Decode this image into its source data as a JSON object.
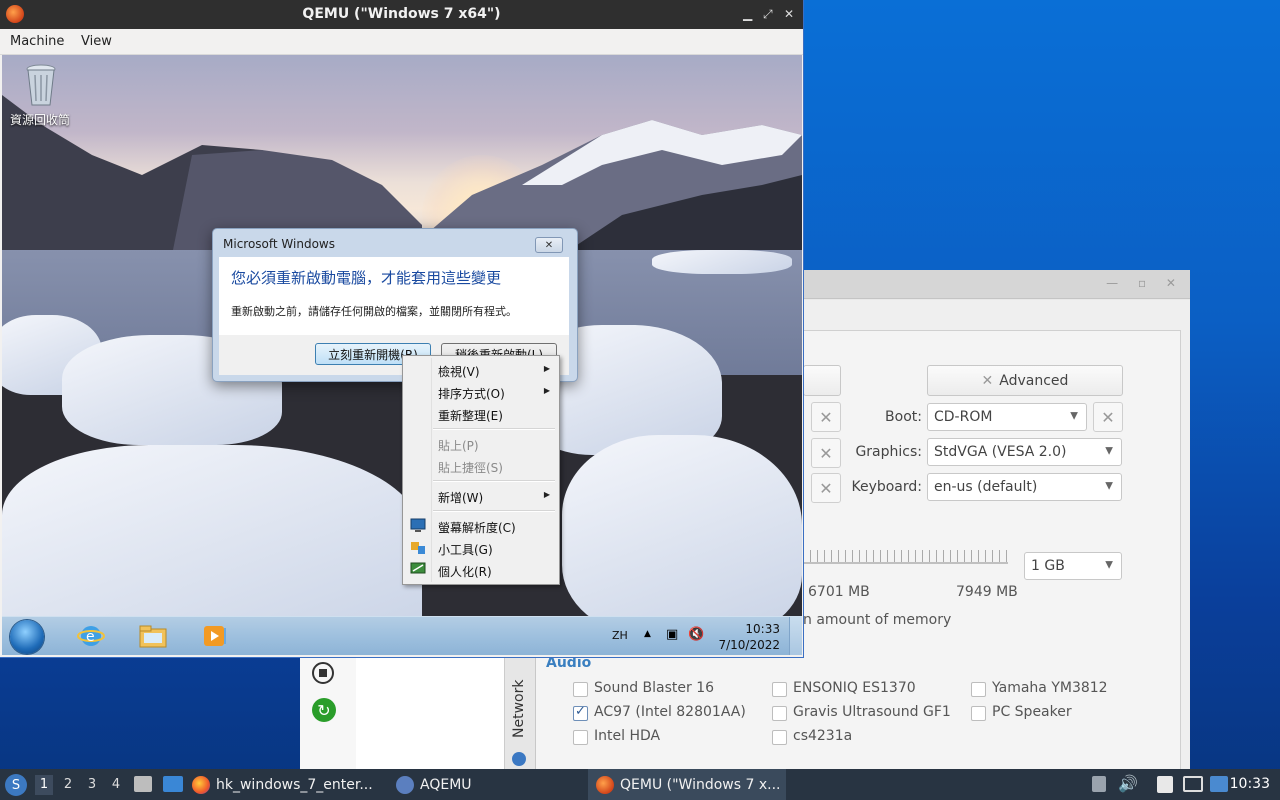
{
  "qemu": {
    "title": "QEMU (\"Windows 7 x64\")",
    "menu": [
      "Machine",
      "View"
    ]
  },
  "guest": {
    "desktop_icon_label": "資源回收筒",
    "dialog": {
      "title": "Microsoft Windows",
      "heading": "您必須重新啟動電腦，才能套用這些變更",
      "text": "重新啟動之前，請儲存任何開啟的檔案，並關閉所有程式。",
      "restart_now": "立刻重新開機(R)",
      "restart_later": "稍後重新啟動(L)",
      "close": "✕"
    },
    "context_menu": [
      {
        "label": "檢視(V)",
        "submenu": true,
        "disabled": false
      },
      {
        "label": "排序方式(O)",
        "submenu": true,
        "disabled": false
      },
      {
        "label": "重新整理(E)",
        "submenu": false,
        "disabled": false
      },
      {
        "label": "貼上(P)",
        "submenu": false,
        "disabled": true
      },
      {
        "label": "貼上捷徑(S)",
        "submenu": false,
        "disabled": true
      },
      {
        "label": "新增(W)",
        "submenu": true,
        "disabled": false
      },
      {
        "label": "螢幕解析度(C)",
        "submenu": false,
        "disabled": false
      },
      {
        "label": "小工具(G)",
        "submenu": false,
        "disabled": false
      },
      {
        "label": "個人化(R)",
        "submenu": false,
        "disabled": false
      }
    ],
    "taskbar": {
      "lang": "ZH",
      "time": "10:33",
      "date": "7/10/2022"
    }
  },
  "aqemu": {
    "advanced_button": "Advanced",
    "boot_label": "Boot:",
    "boot_value": "CD-ROM",
    "graphics_label": "Graphics:",
    "graphics_value": "StdVGA (VESA 2.0)",
    "keyboard_label": "Keyboard:",
    "keyboard_value": "en-us (default)",
    "memory_value": "1 GB",
    "mem_free": "6701 MB",
    "mem_total": "7949 MB",
    "mem_note": "n amount of memory",
    "network_tab": "Network",
    "audio_title": "Audio",
    "audio_cards": [
      {
        "label": "Sound Blaster 16",
        "checked": false
      },
      {
        "label": "ENSONIQ ES1370",
        "checked": false
      },
      {
        "label": "Yamaha YM3812",
        "checked": false
      },
      {
        "label": "AC97 (Intel 82801AA)",
        "checked": true
      },
      {
        "label": "Gravis Ultrasound GF1",
        "checked": false
      },
      {
        "label": "PC Speaker",
        "checked": false
      },
      {
        "label": "Intel HDA",
        "checked": false
      },
      {
        "label": "cs4231a",
        "checked": false
      }
    ]
  },
  "host_taskbar": {
    "workspaces": [
      "1",
      "2",
      "3",
      "4"
    ],
    "tasks": [
      "hk_windows_7_enter...",
      "AQEMU",
      "QEMU (\"Windows 7 x..."
    ],
    "clock": "10:33"
  },
  "colors": {
    "host_taskbar": "#283442",
    "accent_link": "#1a4aa0",
    "audio_title": "#3a7fc0"
  }
}
